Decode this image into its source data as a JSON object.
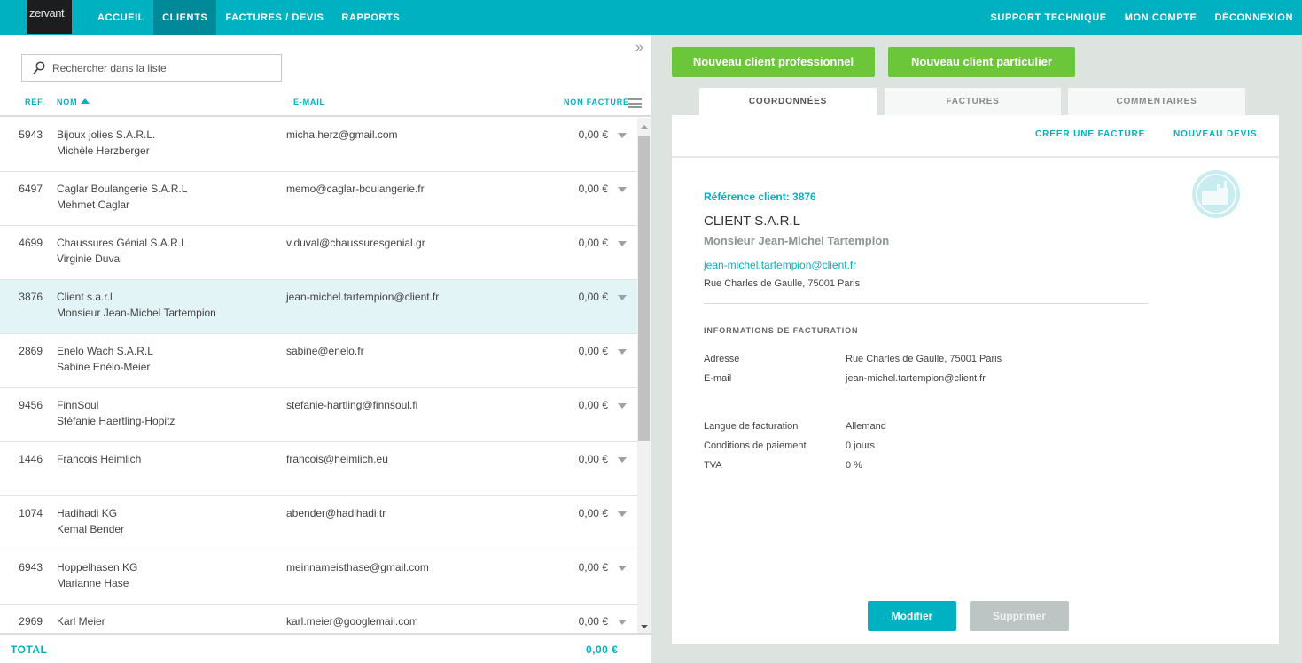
{
  "nav": {
    "logo": "zervant",
    "left": [
      {
        "label": "ACCUEIL",
        "active": false
      },
      {
        "label": "CLIENTS",
        "active": true
      },
      {
        "label": "FACTURES / DEVIS",
        "active": false
      },
      {
        "label": "RAPPORTS",
        "active": false
      }
    ],
    "right": [
      {
        "label": "SUPPORT TECHNIQUE"
      },
      {
        "label": "MON COMPTE"
      },
      {
        "label": "DÉCONNEXION"
      }
    ]
  },
  "list": {
    "collapse_icon": "double-chevron-right-icon",
    "search": {
      "placeholder": "Rechercher dans la liste",
      "value": ""
    },
    "columns": {
      "ref": "RÉF.",
      "name": "NOM",
      "email": "E-MAIL",
      "unbilled": "NON FACTURÉ"
    },
    "sort": {
      "column": "NOM",
      "direction": "ascending"
    },
    "rows": [
      {
        "ref": "5943",
        "company": "Bijoux jolies S.A.R.L.",
        "contact": "Michèle Herzberger",
        "email": "micha.herz@gmail.com",
        "amount": "0,00 €",
        "selected": false
      },
      {
        "ref": "6497",
        "company": "Caglar Boulangerie S.A.R.L",
        "contact": "Mehmet Caglar",
        "email": "memo@caglar-boulangerie.fr",
        "amount": "0,00 €",
        "selected": false
      },
      {
        "ref": "4699",
        "company": "Chaussures Génial S.A.R.L",
        "contact": "Virginie Duval",
        "email": "v.duval@chaussuresgenial.gr",
        "amount": "0,00 €",
        "selected": false
      },
      {
        "ref": "3876",
        "company": "Client s.a.r.l",
        "contact": "Monsieur Jean-Michel Tartempion",
        "email": "jean-michel.tartempion@client.fr",
        "amount": "0,00 €",
        "selected": true
      },
      {
        "ref": "2869",
        "company": "Enelo Wach S.A.R.L",
        "contact": "Sabine Enélo-Meier",
        "email": "sabine@enelo.fr",
        "amount": "0,00 €",
        "selected": false
      },
      {
        "ref": "9456",
        "company": "FinnSoul",
        "contact": "Stéfanie Haertling-Hopitz",
        "email": "stefanie-hartling@finnsoul.fi",
        "amount": "0,00 €",
        "selected": false
      },
      {
        "ref": "1446",
        "company": "Francois Heimlich",
        "contact": "",
        "email": "francois@heimlich.eu",
        "amount": "0,00 €",
        "selected": false
      },
      {
        "ref": "1074",
        "company": "Hadihadi KG",
        "contact": "Kemal Bender",
        "email": "abender@hadihadi.tr",
        "amount": "0,00 €",
        "selected": false
      },
      {
        "ref": "6943",
        "company": "Hoppelhasen KG",
        "contact": "Marianne Hase",
        "email": "meinnameisthase@gmail.com",
        "amount": "0,00 €",
        "selected": false
      },
      {
        "ref": "2969",
        "company": "Karl Meier",
        "contact": "",
        "email": "karl.meier@googlemail.com",
        "amount": "0,00 €",
        "selected": false
      }
    ],
    "total": {
      "label": "TOTAL",
      "value": "0,00 €"
    }
  },
  "actions": {
    "new_pro": "Nouveau client professionnel",
    "new_private": "Nouveau client particulier"
  },
  "tabs": [
    {
      "label": "COORDONNÉES",
      "active": true
    },
    {
      "label": "FACTURES",
      "active": false
    },
    {
      "label": "COMMENTAIRES",
      "active": false
    }
  ],
  "detail": {
    "create_invoice": "CRÉER UNE FACTURE",
    "new_quote": "NOUVEAU DEVIS",
    "reference": "Référence client: 3876",
    "company": "CLIENT S.A.R.L",
    "contact": "Monsieur Jean-Michel Tartempion",
    "email": "jean-michel.tartempion@client.fr",
    "address": "Rue Charles de Gaulle, 75001 Paris",
    "client_type_icon": "factory-icon",
    "billing_title": "INFORMATIONS DE FACTURATION",
    "billing": [
      {
        "key": "Adresse",
        "value": "Rue Charles de Gaulle, 75001 Paris"
      },
      {
        "key": "E-mail",
        "value": "jean-michel.tartempion@client.fr"
      },
      {
        "key": "Langue de facturation",
        "value": "Allemand"
      },
      {
        "key": "Conditions de paiement",
        "value": "0 jours"
      },
      {
        "key": "TVA",
        "value": "0 %"
      }
    ],
    "edit": "Modifier",
    "delete": "Supprimer"
  },
  "colors": {
    "brand": "#00b2c1",
    "green": "#6cc63a",
    "selected_row": "#e3f4f7",
    "disabled_button": "#bcc5c3"
  }
}
